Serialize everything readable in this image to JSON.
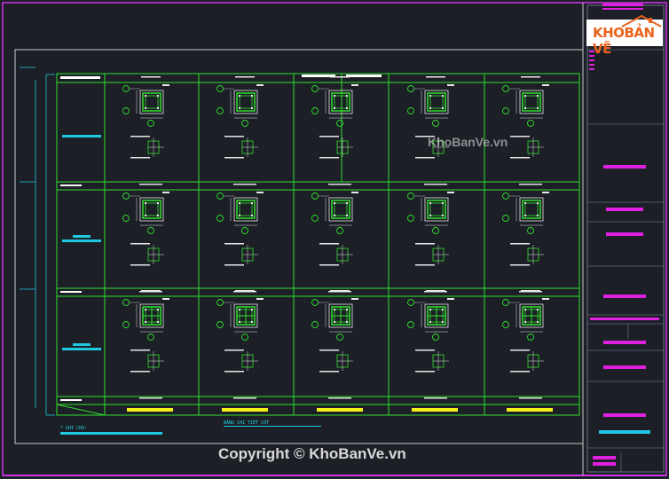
{
  "watermark": {
    "brand_text": "KhoBanVe.vn"
  },
  "copyright": {
    "text": "Copyright © KhoBanVe.vn"
  },
  "logo": {
    "brand_part1": "KHO",
    "brand_part2": "BẢN VẼ"
  },
  "drawing": {
    "title": "BẢNG CHI TIẾT CỘT",
    "note_label": "* GHI CHÚ:"
  },
  "colors": {
    "background": "#1c1f26",
    "frame": "#d234e8",
    "grid": "#31e02e",
    "cyan": "#1fc8e0",
    "yellow": "#f2f21a",
    "white": "#ffffff",
    "magenta": "#e020e0"
  }
}
